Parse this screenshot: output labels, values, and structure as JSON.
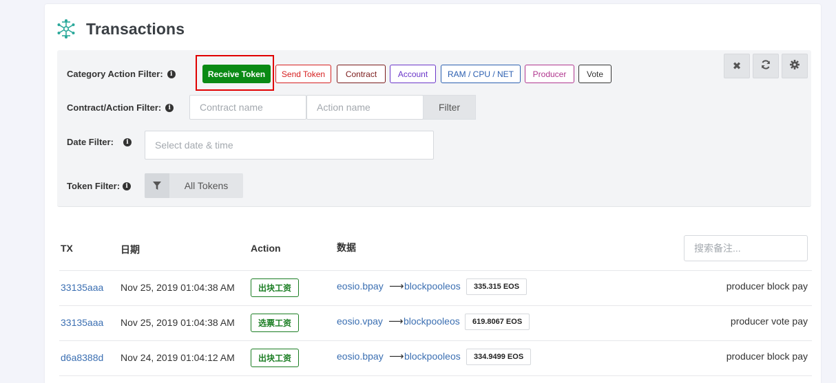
{
  "title": "Transactions",
  "filters": {
    "category_label": "Category Action Filter:",
    "category_buttons": [
      {
        "label": "Receive Token",
        "color": "#0a8a14",
        "active": true
      },
      {
        "label": "Send Token",
        "color": "#d61f1f"
      },
      {
        "label": "Contract",
        "color": "#7a1a1a"
      },
      {
        "label": "Account",
        "color": "#6a35c9"
      },
      {
        "label": "RAM / CPU / NET",
        "color": "#2b5fb0"
      },
      {
        "label": "Producer",
        "color": "#b0358e"
      },
      {
        "label": "Vote",
        "color": "#333333"
      }
    ],
    "contract_action_label": "Contract/Action Filter:",
    "contract_placeholder": "Contract name",
    "action_placeholder": "Action name",
    "filter_button": "Filter",
    "date_label": "Date Filter:",
    "date_placeholder": "Select date & time",
    "token_label": "Token Filter:",
    "token_value": "All Tokens",
    "info_glyph": "i",
    "tool_icons": [
      "close-icon",
      "refresh-icon",
      "gear-icon"
    ]
  },
  "table": {
    "headers": {
      "tx": "TX",
      "date": "日期",
      "action": "Action",
      "data": "数据"
    },
    "memo_search_placeholder": "搜索备注...",
    "arrow": "⟶",
    "rows": [
      {
        "tx": "33135aaa",
        "date": "Nov 25, 2019 01:04:38 AM",
        "action": "出块工资",
        "from": "eosio.bpay",
        "to": "blockpooleos",
        "amount": "335.315 EOS",
        "memo": "producer block pay"
      },
      {
        "tx": "33135aaa",
        "date": "Nov 25, 2019 01:04:38 AM",
        "action": "选票工资",
        "from": "eosio.vpay",
        "to": "blockpooleos",
        "amount": "619.8067 EOS",
        "memo": "producer vote pay"
      },
      {
        "tx": "d6a8388d",
        "date": "Nov 24, 2019 01:04:12 AM",
        "action": "出块工资",
        "from": "eosio.bpay",
        "to": "blockpooleos",
        "amount": "334.9499 EOS",
        "memo": "producer block pay"
      }
    ]
  },
  "colors": {
    "accent_green": "#0a8a14",
    "link_blue": "#3b6fb2",
    "highlight_red": "#e00000"
  }
}
